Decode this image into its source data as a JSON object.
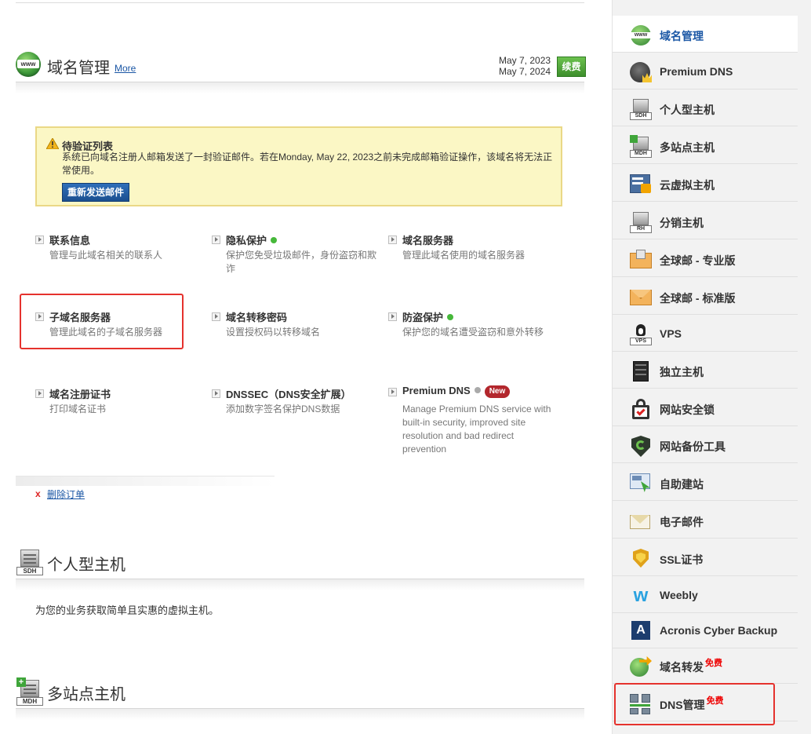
{
  "domain_section": {
    "title": "域名管理",
    "more_link": "More",
    "date_start": "May 7, 2023",
    "date_end": "May 7, 2024",
    "renew_label": "续费"
  },
  "alert": {
    "title": "待验证列表",
    "text": "系统已向域名注册人邮箱发送了一封验证邮件。若在Monday, May 22, 2023之前未完成邮箱验证操作，该域名将无法正常使用。",
    "button_label": "重新发送邮件"
  },
  "features": [
    {
      "title": "联系信息",
      "desc": "管理与此域名相关的联系人"
    },
    {
      "title": "隐私保护",
      "desc": "保护您免受垃圾邮件，身份盗窃和欺诈"
    },
    {
      "title": "域名服务器",
      "desc": "管理此域名使用的域名服务器"
    },
    {
      "title": "子域名服务器",
      "desc": "管理此域名的子域名服务器"
    },
    {
      "title": "域名转移密码",
      "desc": "设置授权码以转移域名"
    },
    {
      "title": "防盗保护",
      "desc": "保护您的域名遭受盗窃和意外转移"
    },
    {
      "title": "域名注册证书",
      "desc": "打印域名证书"
    },
    {
      "title": "DNSSEC（DNS安全扩展）",
      "desc": "添加数字签名保护DNS数据"
    },
    {
      "title": "Premium DNS",
      "desc": "Manage Premium DNS service with built-in security, improved site resolution and bad redirect prevention",
      "badge": "New"
    }
  ],
  "delete_order": {
    "mark": "x",
    "label": "删除订单"
  },
  "hosting_section": {
    "title": "个人型主机",
    "icon_label": "SDH",
    "desc": "为您的业务获取简单且实惠的虚拟主机。"
  },
  "multi_site_section": {
    "title": "多站点主机",
    "icon_label": "MDH"
  },
  "sidebar": {
    "items": [
      {
        "label": "域名管理",
        "icon": "globe-icon"
      },
      {
        "label": "Premium DNS",
        "icon": "premium-dns-icon"
      },
      {
        "label": "个人型主机",
        "icon": "sdh-server-icon",
        "icon_label": "SDH"
      },
      {
        "label": "多站点主机",
        "icon": "mdh-server-icon",
        "icon_label": "MDH"
      },
      {
        "label": "云虚拟主机",
        "icon": "cloud-hosting-icon"
      },
      {
        "label": "分销主机",
        "icon": "rh-server-icon",
        "icon_label": "RH"
      },
      {
        "label": "全球邮 - 专业版",
        "icon": "mail-pro-icon"
      },
      {
        "label": "全球邮 - 标准版",
        "icon": "mail-standard-icon"
      },
      {
        "label": "VPS",
        "icon": "vps-icon",
        "icon_label": "VPS"
      },
      {
        "label": "独立主机",
        "icon": "dedicated-server-icon"
      },
      {
        "label": "网站安全锁",
        "icon": "site-lock-icon"
      },
      {
        "label": "网站备份工具",
        "icon": "backup-shield-icon"
      },
      {
        "label": "自助建站",
        "icon": "site-builder-icon"
      },
      {
        "label": "电子邮件",
        "icon": "email-icon"
      },
      {
        "label": "SSL证书",
        "icon": "ssl-shield-icon"
      },
      {
        "label": "Weebly",
        "icon": "weebly-icon"
      },
      {
        "label": "Acronis Cyber Backup",
        "icon": "acronis-icon"
      },
      {
        "label": "域名转发",
        "icon": "forwarding-icon",
        "badge": "免费"
      },
      {
        "label": "DNS管理",
        "icon": "dns-management-icon",
        "badge": "免费"
      }
    ]
  },
  "colors": {
    "link": "#1b57a5",
    "renew_green": "#4aa637",
    "alert_bg": "#fbf7c5",
    "alert_border": "#ead886",
    "highlight_red": "#e5322d",
    "badge_red": "#b3272d"
  }
}
